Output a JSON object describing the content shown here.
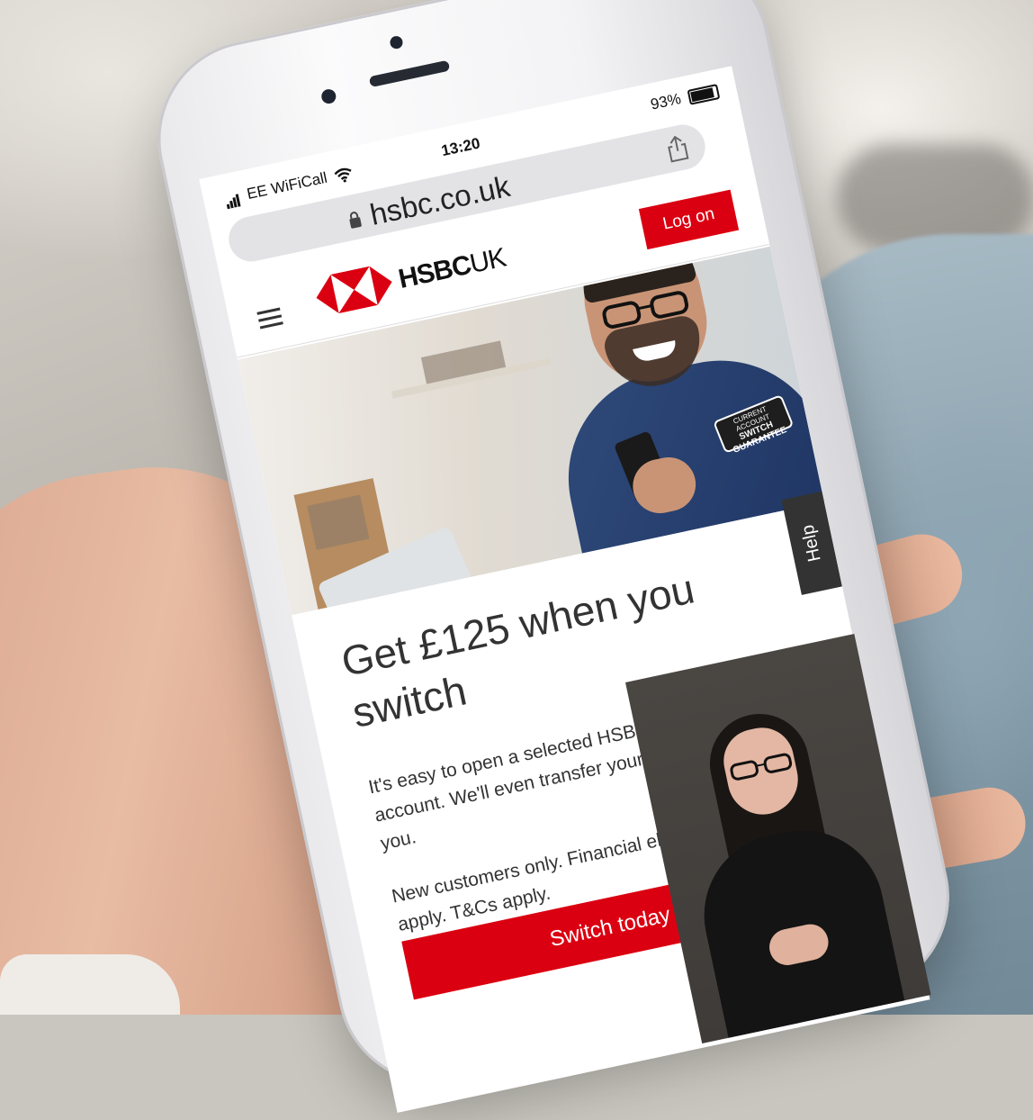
{
  "status_bar": {
    "carrier": "EE WiFiCall",
    "time": "13:20",
    "battery": "93%"
  },
  "browser": {
    "url": "hsbc.co.uk"
  },
  "header": {
    "logo_brand": "HSBC",
    "logo_region": "UK",
    "logon_label": "Log on"
  },
  "hero": {
    "badge_line1": "CURRENT ACCOUNT",
    "badge_line2": "SWITCH GUARANTEE"
  },
  "content": {
    "headline": "Get £125 when you switch",
    "paragraph1": "It's easy to open a selected HSBC current account. We'll even transfer your payments for you.",
    "paragraph2": "New customers only. Financial eligibility criteria apply. T&Cs apply.",
    "cta_label": "Switch today"
  },
  "help_tab": {
    "label": "Help"
  },
  "colors": {
    "brand_red": "#db0011",
    "help_tab": "#333333"
  },
  "icons": [
    "signal-icon",
    "wifi-icon",
    "battery-icon",
    "lock-icon",
    "share-icon",
    "menu-icon",
    "hsbc-hexagon-logo"
  ]
}
